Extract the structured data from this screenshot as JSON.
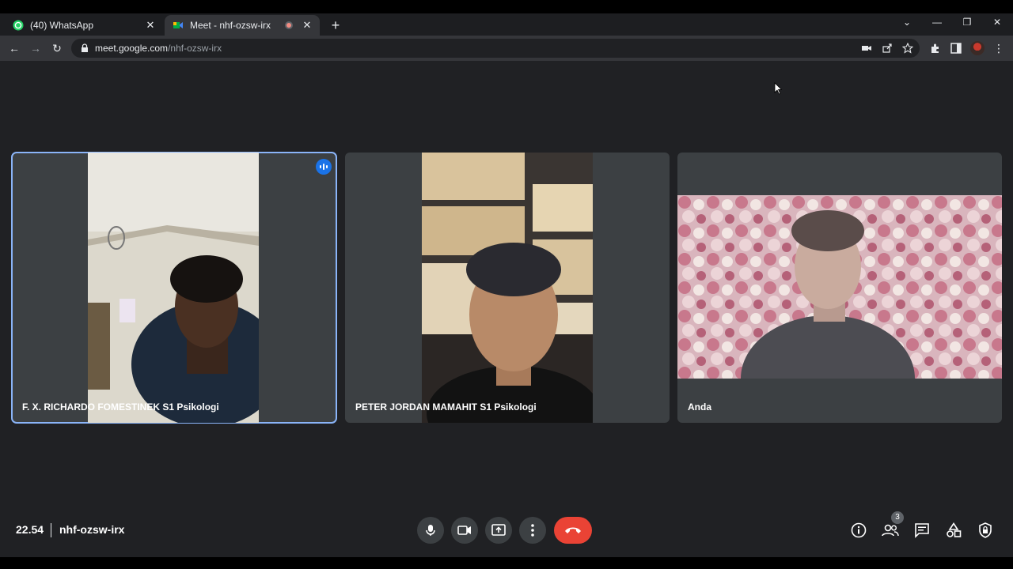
{
  "browser": {
    "tabs": [
      {
        "title": "(40) WhatsApp",
        "favicon": "whatsapp-icon"
      },
      {
        "title": "Meet - nhf-ozsw-irx",
        "favicon": "meet-icon",
        "recording": true
      }
    ],
    "url_host": "meet.google.com",
    "url_path": "/nhf-ozsw-irx"
  },
  "participants": [
    {
      "name": "F. X. RICHARDO FOMESTINEK S1 Psikologi",
      "speaking": true
    },
    {
      "name": "PETER JORDAN MAMAHIT S1 Psikologi",
      "speaking": false
    },
    {
      "name": "Anda",
      "speaking": false
    }
  ],
  "meeting": {
    "time": "22.54",
    "code": "nhf-ozsw-irx",
    "participant_count": "3"
  },
  "colors": {
    "background": "#202124",
    "tile": "#3c4043",
    "active_outline": "#8ab4f8",
    "hangup": "#ea4335"
  }
}
